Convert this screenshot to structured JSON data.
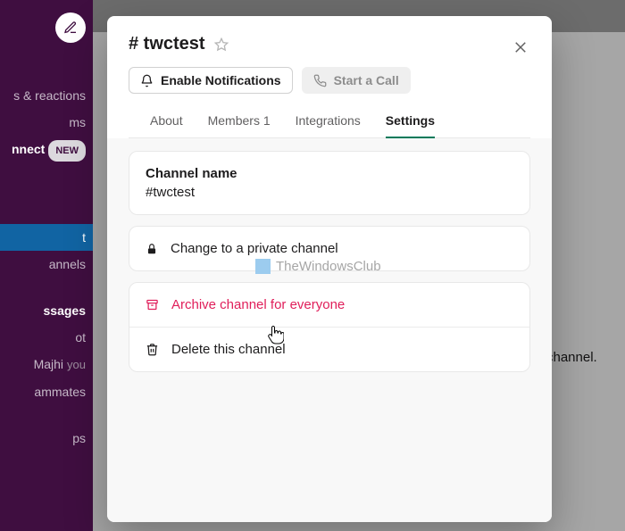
{
  "sidebar": {
    "items": [
      {
        "label": "s & reactions"
      },
      {
        "label": "ms"
      },
      {
        "label": "nnect",
        "bold": true,
        "badge": "NEW"
      },
      {
        "label": ""
      },
      {
        "label": ""
      },
      {
        "label": ""
      },
      {
        "label": "t",
        "active": true
      },
      {
        "label": "annels"
      },
      {
        "label": ""
      },
      {
        "label": "ssages",
        "bold": true
      },
      {
        "label": "ot"
      },
      {
        "label": "Majhi",
        "you": "you"
      },
      {
        "label": "ammates"
      },
      {
        "label": ""
      },
      {
        "label": "ps"
      }
    ]
  },
  "background": {
    "snippet": "channel."
  },
  "modal": {
    "title": "# twctest",
    "buttons": {
      "notifications": "Enable Notifications",
      "call": "Start a Call"
    },
    "tabs": {
      "about": "About",
      "members": "Members 1",
      "integrations": "Integrations",
      "settings": "Settings"
    },
    "settings": {
      "channel_name_label": "Channel name",
      "channel_name_value": "#twctest",
      "private": "Change to a private channel",
      "archive": "Archive channel for everyone",
      "delete": "Delete this channel"
    }
  },
  "watermark": "TheWindowsClub"
}
